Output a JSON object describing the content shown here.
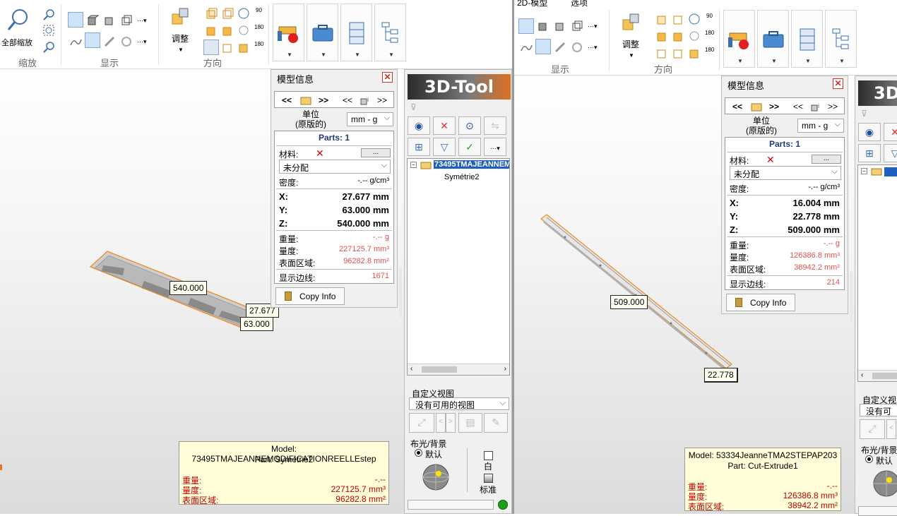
{
  "left": {
    "ribbon": {
      "zoom_all": "全部缩放",
      "groups": [
        "缩放",
        "显示",
        "方向"
      ],
      "adjust": "调整",
      "rot": [
        "90",
        "180",
        "180"
      ]
    },
    "panel": {
      "title": "模型信息",
      "nav": [
        "<<",
        ">>",
        "<<",
        ">>"
      ],
      "unit_label": "单位\n(原版的)",
      "unit_value": "mm - g",
      "parts": "Parts: 1",
      "material_label": "材料:",
      "material_btn": "...",
      "material_value": "未分配",
      "density_label": "密度:",
      "density_value": "-.-- g/cm³",
      "x_label": "X:",
      "x_value": "27.677 mm",
      "y_label": "Y:",
      "y_value": "63.000 mm",
      "z_label": "Z:",
      "z_value": "540.000 mm",
      "weight_label": "重量:",
      "weight_value": "-.-- g",
      "volume_label": "量度:",
      "volume_value": "227125.7 mm³",
      "area_label": "表面区域:",
      "area_value": "96282.8 mm²",
      "edges_label": "显示边线:",
      "edges_value": "1671",
      "copy_btn": "Copy Info"
    },
    "tool": {
      "logo": "3D-Tool",
      "tree_root": "73495TMAJEANNEM",
      "tree_child": "Symétrie2",
      "custom_view": "自定义视图",
      "no_view": "没有可用的视图",
      "light_bg": "布光/背景",
      "default": "默认",
      "white": "白",
      "standard": "标准"
    },
    "dims": {
      "len": "540.000",
      "w": "27.677",
      "h": "63.000"
    },
    "info": {
      "model": "Model: 73495TMAJEANNEMODIFICATIONREELLEstep",
      "part": "Part: Symétrie2",
      "weight_label": "重量:",
      "weight_value": "-.--",
      "volume_label": "量度:",
      "volume_value": "227125.7 mm³",
      "area_label": "表面区域:",
      "area_value": "96282.8 mm²"
    }
  },
  "right": {
    "menu": [
      "2D-模型",
      "选项"
    ],
    "ribbon": {
      "groups": [
        "显示",
        "方向"
      ],
      "adjust": "调整",
      "rot": [
        "90",
        "180",
        "180"
      ]
    },
    "panel": {
      "title": "模型信息",
      "nav": [
        "<<",
        ">>",
        "<<",
        ">>"
      ],
      "unit_label": "单位\n(原版的)",
      "unit_value": "mm - g",
      "parts": "Parts: 1",
      "material_label": "材料:",
      "material_btn": "...",
      "material_value": "未分配",
      "density_label": "密度:",
      "density_value": "-.-- g/cm³",
      "x_label": "X:",
      "x_value": "16.004 mm",
      "y_label": "Y:",
      "y_value": "22.778 mm",
      "z_label": "Z:",
      "z_value": "509.000 mm",
      "weight_label": "重量:",
      "weight_value": "-.-- g",
      "volume_label": "量度:",
      "volume_value": "126386.8 mm³",
      "area_label": "表面区域:",
      "area_value": "38942.2 mm²",
      "edges_label": "显示边线:",
      "edges_value": "214",
      "copy_btn": "Copy Info"
    },
    "tool": {
      "logo": "3D",
      "custom_view": "自定义视",
      "no_view": "没有可用",
      "light_bg": "布光/背景",
      "default": "默认"
    },
    "dims": {
      "len": "509.000",
      "h": "22.778"
    },
    "info": {
      "model": "Model: 53334JeanneTMA2STEPAP203",
      "part": "Part: Cut-Extrude1",
      "weight_label": "重量:",
      "weight_value": "-.--",
      "volume_label": "量度:",
      "volume_value": "126386.8 mm³",
      "area_label": "表面区域:",
      "area_value": "38942.2 mm²"
    }
  }
}
